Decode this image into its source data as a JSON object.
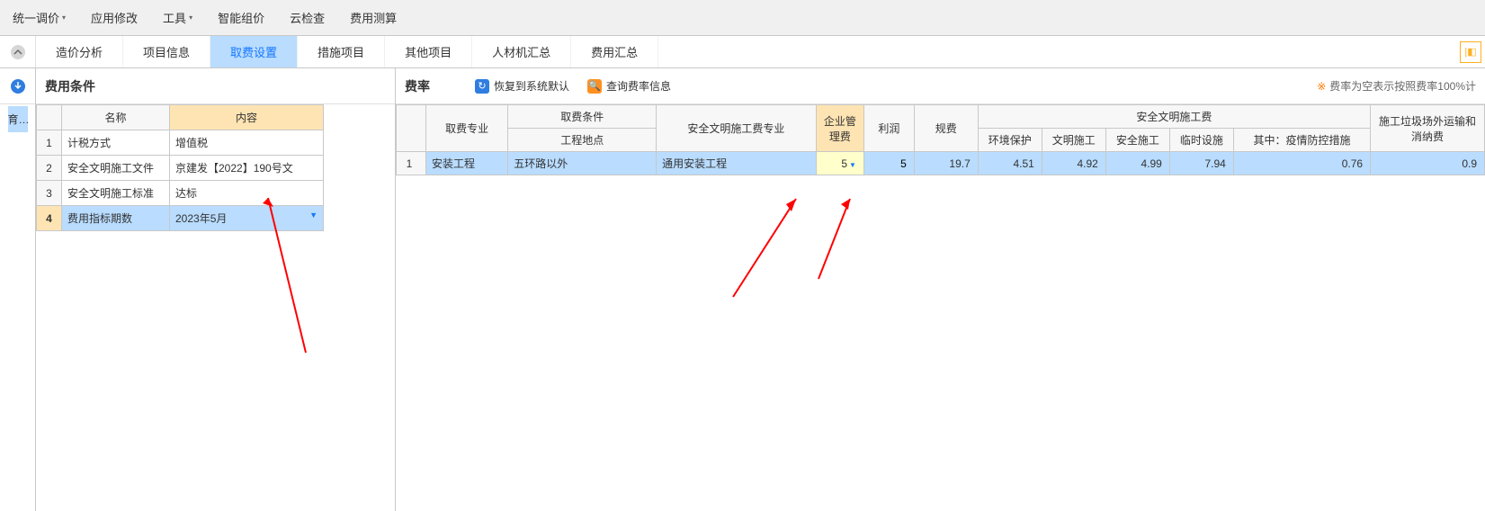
{
  "menu": {
    "items": [
      "统一调价",
      "应用修改",
      "工具",
      "智能组价",
      "云检查",
      "费用测算"
    ],
    "dropdown_flags": [
      true,
      false,
      true,
      false,
      false,
      false
    ]
  },
  "nav_left_icon": "chevron-up-circle",
  "nav_tabs": [
    "造价分析",
    "项目信息",
    "取费设置",
    "措施项目",
    "其他项目",
    "人材机汇总",
    "费用汇总"
  ],
  "nav_active_index": 2,
  "far_left": {
    "btn_icon": "download-circle",
    "tab_label": "育…"
  },
  "left_panel": {
    "title": "费用条件",
    "headers": {
      "idx": "",
      "name": "名称",
      "content": "内容"
    },
    "rows": [
      {
        "idx": "1",
        "name": "计税方式",
        "content": "增值税"
      },
      {
        "idx": "2",
        "name": "安全文明施工文件",
        "content": "京建发【2022】190号文"
      },
      {
        "idx": "3",
        "name": "安全文明施工标准",
        "content": "达标"
      },
      {
        "idx": "4",
        "name": "费用指标期数",
        "content": "2023年5月"
      }
    ],
    "selected_index": 3
  },
  "right_panel": {
    "title": "费率",
    "restore_label": "恢复到系统默认",
    "query_label": "查询费率信息",
    "note": "费率为空表示按照费率100%计",
    "headers": {
      "row1": {
        "idx": "",
        "fee_major": "取费专业",
        "fee_cond": "取费条件",
        "safety_major": "安全文明施工费专业",
        "mgmt_fee": "企业管理费",
        "profit": "利润",
        "gauge_fee": "规费",
        "safety_fee_group": "安全文明施工费",
        "waste_fee": "施工垃圾场外运输和消纳费"
      },
      "row2": {
        "loc": "工程地点",
        "env": "环境保护",
        "civ": "文明施工",
        "safe": "安全施工",
        "temp": "临时设施",
        "epi": "其中：疫情防控措施"
      }
    },
    "data_row": {
      "idx": "1",
      "fee_major": "安装工程",
      "loc": "五环路以外",
      "safety_major": "通用安装工程",
      "mgmt_fee": "5",
      "profit": "5",
      "gauge_fee": "19.7",
      "env": "4.51",
      "civ": "4.92",
      "safe": "4.99",
      "temp": "7.94",
      "epi": "0.76",
      "waste": "0.9"
    }
  }
}
